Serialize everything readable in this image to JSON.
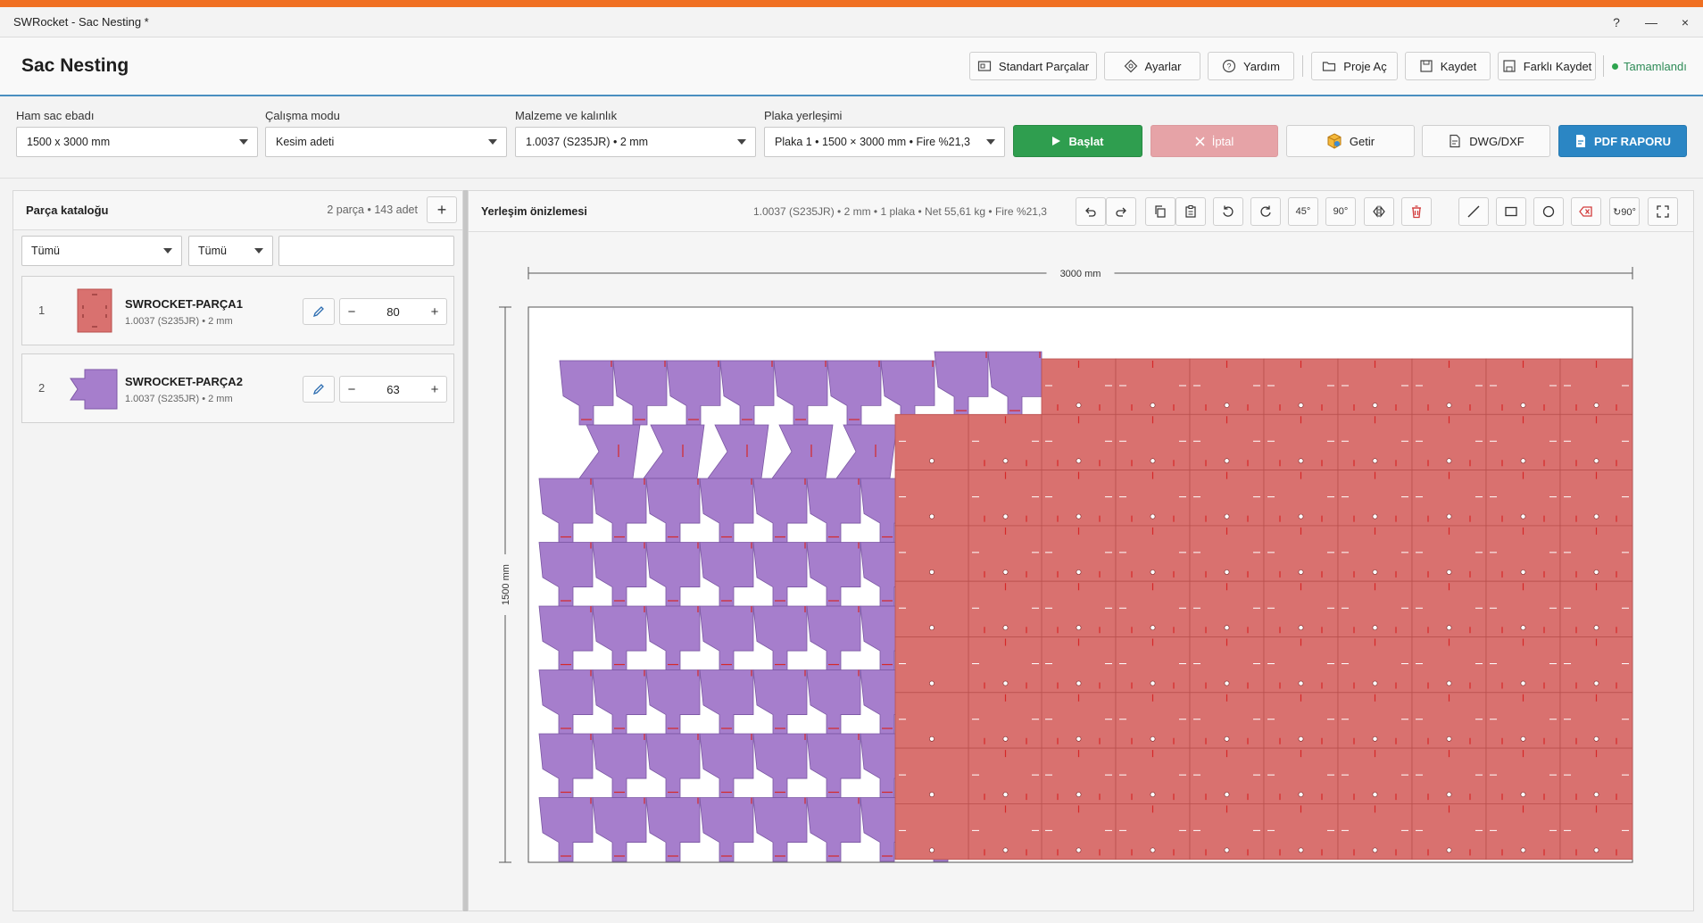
{
  "window": {
    "title": "SWRocket - Sac Nesting *",
    "help": "?",
    "minimize": "—",
    "close": "×"
  },
  "header": {
    "page_title": "Sac Nesting",
    "buttons": {
      "standard_parts": "Standart Parçalar",
      "settings": "Ayarlar",
      "help": "Yardım",
      "open_project": "Proje Aç",
      "save": "Kaydet",
      "save_as": "Farklı Kaydet"
    },
    "status": "Tamamlandı"
  },
  "toolbar": {
    "raw_sheet_label": "Ham sac ebadı",
    "raw_sheet_value": "1500 x 3000 mm",
    "mode_label": "Çalışma modu",
    "mode_value": "Kesim adeti",
    "material_label": "Malzeme ve kalınlık",
    "material_value": "1.0037 (S235JR)  •  2 mm",
    "placement_label": "Plaka yerleşimi",
    "placement_value": "Plaka 1  •  1500 × 3000 mm  •  Fire %21,3",
    "start": "Başlat",
    "cancel": "İptal",
    "fetch": "Getir",
    "dwg": "DWG/DXF",
    "pdf": "PDF RAPORU"
  },
  "catalog": {
    "title": "Parça kataloğu",
    "meta": "2 parça  •  143 adet",
    "add": "+",
    "filter1": "Tümü",
    "filter2": "Tümü",
    "search_value": "",
    "parts": [
      {
        "index": "1",
        "name": "SWROCKET-PARÇA1",
        "sub": "1.0037 (S235JR)  •  2 mm",
        "qty": "80"
      },
      {
        "index": "2",
        "name": "SWROCKET-PARÇA2",
        "sub": "1.0037 (S235JR)  •  2 mm",
        "qty": "63"
      }
    ],
    "minus": "−",
    "plus": "+"
  },
  "preview": {
    "title": "Yerleşim önizlemesi",
    "meta": "1.0037 (S235JR)  •  2 mm  •  1 plaka  •  Net 55,61 kg  •  Fire %21,3",
    "tools": [
      "undo-icon",
      "redo-icon",
      "copy-icon",
      "paste-icon",
      "rotate-left-icon",
      "rotate-right-icon",
      "45°",
      "90°",
      "mirror-icon",
      "delete-icon",
      "line-icon",
      "rectangle-icon",
      "circle-icon",
      "eraser-icon",
      "↻90°",
      "fullscreen-icon"
    ],
    "width_label": "3000 mm",
    "height_label": "1500 mm"
  },
  "colors": {
    "accent": "#f07022",
    "part1": "#d9716f",
    "part2": "#a67ecc",
    "start": "#2f9e4f",
    "pdf": "#2b86c4"
  }
}
